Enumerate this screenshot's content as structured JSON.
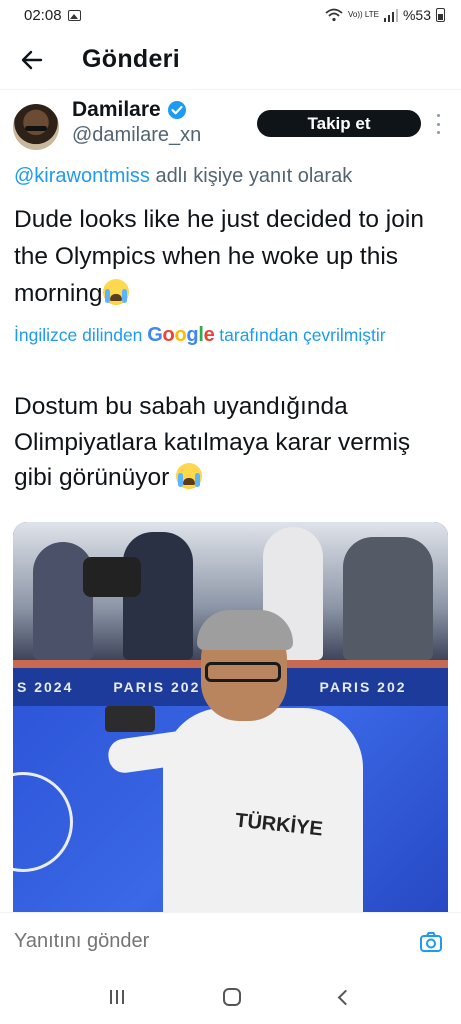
{
  "status_bar": {
    "time": "02:08",
    "volte": "Vo)) LTE",
    "battery": "%53"
  },
  "header": {
    "title": "Gönderi"
  },
  "tweet": {
    "author": {
      "display_name": "Damilare",
      "handle": "@damilare_xn",
      "verified": true
    },
    "follow_label": "Takip et",
    "reply_context": {
      "mention": "@kirawontmiss",
      "suffix": " adlı kişiye yanıt olarak"
    },
    "text": "Dude looks like he just decided to join the Olympics when he woke up this morning",
    "translation_credit": {
      "prefix": "İngilizce dilinden ",
      "brand": "Google",
      "suffix": " tarafından çevrilmiştir"
    },
    "translated_text": "Dostum bu sabah uyandığında Olimpiyatlara katılmaya karar vermiş gibi görünüyor",
    "media": {
      "banner_text_1": "S 2024",
      "banner_text_2": "PARIS 202",
      "banner_text_3": "2024",
      "banner_text_4": "PARIS 202",
      "shirt_text": "TÜRKİYE"
    }
  },
  "reply_bar": {
    "placeholder": "Yanıtını gönder"
  },
  "colors": {
    "accent": "#1d9bf0",
    "text": "#0f1419",
    "secondary": "#536471",
    "follow_bg": "#0f1419"
  }
}
